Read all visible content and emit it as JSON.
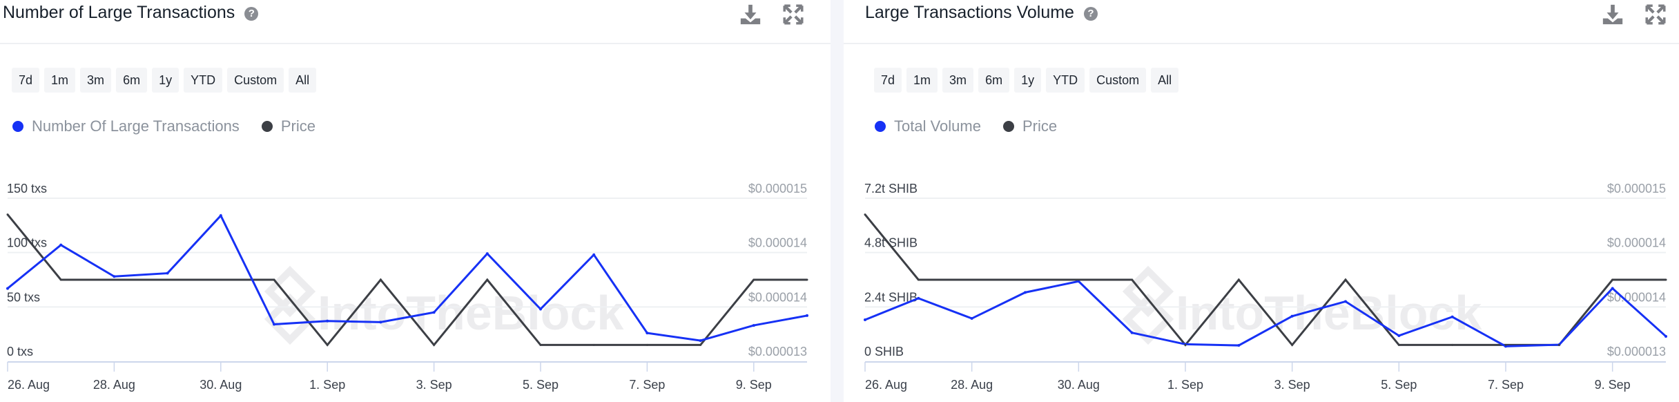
{
  "colors": {
    "series": "#1631f5",
    "price": "#3c3f45",
    "grid": "#eef0f3",
    "axis": "#ccd6eb"
  },
  "watermark": "IntoTheBlock",
  "range_buttons": [
    "7d",
    "1m",
    "3m",
    "6m",
    "1y",
    "YTD",
    "Custom",
    "All"
  ],
  "icons": {
    "download": "download-icon",
    "expand": "expand-icon",
    "help": "help-icon"
  },
  "panels": [
    {
      "title": "Number of Large Transactions",
      "help": "?",
      "legend": [
        {
          "label": "Number Of Large Transactions",
          "color": "#1631f5"
        },
        {
          "label": "Price",
          "color": "#3c3f45"
        }
      ]
    },
    {
      "title": "Large Transactions Volume",
      "help": "?",
      "legend": [
        {
          "label": "Total Volume",
          "color": "#1631f5"
        },
        {
          "label": "Price",
          "color": "#3c3f45"
        }
      ]
    }
  ],
  "chart_data": [
    {
      "type": "line",
      "title": "Number of Large Transactions",
      "x": [
        "26 Aug",
        "27 Aug",
        "28 Aug",
        "29 Aug",
        "30 Aug",
        "31 Aug",
        "1 Sep",
        "2 Sep",
        "3 Sep",
        "4 Sep",
        "5 Sep",
        "6 Sep",
        "7 Sep",
        "8 Sep",
        "9 Sep",
        "10 Sep"
      ],
      "x_tick_labels": [
        "26. Aug",
        "28. Aug",
        "30. Aug",
        "1. Sep",
        "3. Sep",
        "5. Sep",
        "7. Sep",
        "9. Sep"
      ],
      "y_left": {
        "range": [
          0,
          150
        ],
        "ticks": [
          0,
          50,
          100,
          150
        ],
        "tick_labels": [
          "0 txs",
          "50 txs",
          "100 txs",
          "150 txs"
        ]
      },
      "y_right": {
        "range": [
          1.3e-05,
          1.5e-05
        ],
        "tick_labels": [
          "$0.000013",
          "$0.000014",
          "$0.000014",
          "$0.000015"
        ]
      },
      "grid": true,
      "legend_position": "top-left",
      "series": [
        {
          "name": "Number Of Large Transactions",
          "axis": "left",
          "values": [
            67,
            107,
            78,
            81,
            134,
            34,
            37,
            36,
            45,
            99,
            48,
            98,
            26,
            19,
            33,
            42
          ]
        },
        {
          "name": "Price",
          "axis": "right",
          "values": [
            1.48e-05,
            1.4e-05,
            1.4e-05,
            1.4e-05,
            1.4e-05,
            1.4e-05,
            1.32e-05,
            1.4e-05,
            1.32e-05,
            1.4e-05,
            1.32e-05,
            1.32e-05,
            1.32e-05,
            1.32e-05,
            1.4e-05,
            1.4e-05
          ]
        }
      ]
    },
    {
      "type": "line",
      "title": "Large Transactions Volume",
      "x": [
        "26 Aug",
        "27 Aug",
        "28 Aug",
        "29 Aug",
        "30 Aug",
        "31 Aug",
        "1 Sep",
        "2 Sep",
        "3 Sep",
        "4 Sep",
        "5 Sep",
        "6 Sep",
        "7 Sep",
        "8 Sep",
        "9 Sep",
        "10 Sep"
      ],
      "x_tick_labels": [
        "26. Aug",
        "28. Aug",
        "30. Aug",
        "1. Sep",
        "3. Sep",
        "5. Sep",
        "7. Sep",
        "9. Sep"
      ],
      "y_left": {
        "range": [
          0,
          7.2
        ],
        "unit": "trillion SHIB",
        "ticks": [
          0,
          2.4,
          4.8,
          7.2
        ],
        "tick_labels": [
          "0 SHIB",
          "2.4t SHIB",
          "4.8t SHIB",
          "7.2t SHIB"
        ]
      },
      "y_right": {
        "range": [
          1.3e-05,
          1.5e-05
        ],
        "tick_labels": [
          "$0.000013",
          "$0.000014",
          "$0.000014",
          "$0.000015"
        ]
      },
      "grid": true,
      "legend_position": "top-left",
      "series": [
        {
          "name": "Total Volume",
          "axis": "left",
          "values": [
            1.83,
            2.78,
            1.89,
            3.04,
            3.53,
            1.26,
            0.75,
            0.7,
            1.99,
            2.64,
            1.13,
            1.96,
            0.66,
            0.73,
            3.22,
            1.1
          ]
        },
        {
          "name": "Price",
          "axis": "right",
          "values": [
            1.48e-05,
            1.4e-05,
            1.4e-05,
            1.4e-05,
            1.4e-05,
            1.4e-05,
            1.32e-05,
            1.4e-05,
            1.32e-05,
            1.4e-05,
            1.32e-05,
            1.32e-05,
            1.32e-05,
            1.32e-05,
            1.4e-05,
            1.4e-05
          ]
        }
      ]
    }
  ]
}
